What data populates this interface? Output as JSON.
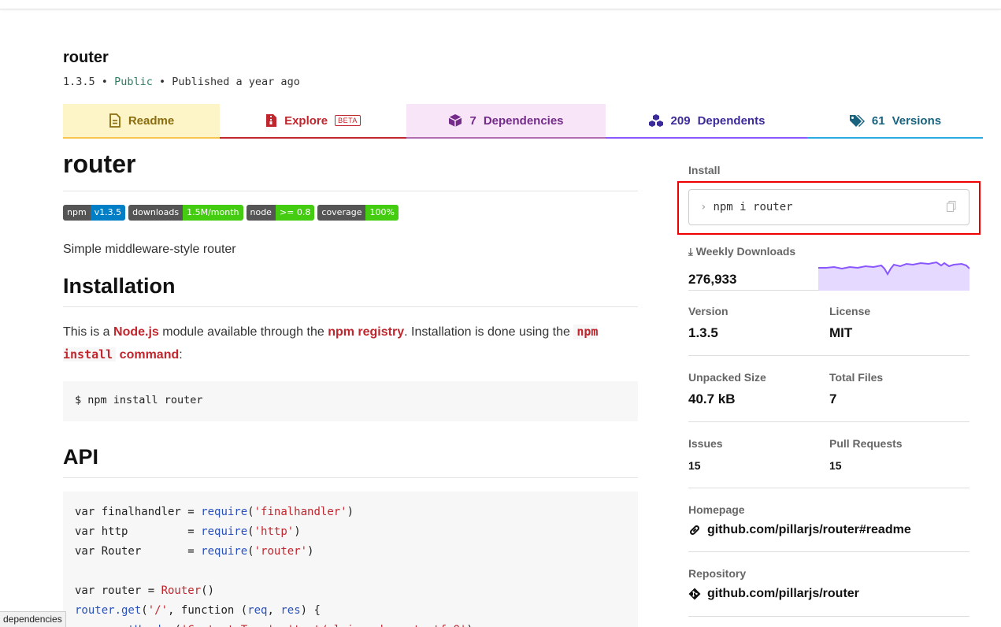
{
  "package": {
    "name": "router",
    "version": "1.3.5",
    "visibility": "Public",
    "published": "Published a year ago",
    "separator": "•"
  },
  "tabs": {
    "readme": "Readme",
    "explore": "Explore",
    "explore_badge": "BETA",
    "deps_count": "7",
    "deps_label": "Dependencies",
    "dependents_count": "209",
    "dependents_label": "Dependents",
    "versions_count": "61",
    "versions_label": "Versions"
  },
  "readme": {
    "title": "router",
    "badges": [
      {
        "label": "npm",
        "value": "v1.3.5",
        "color": "#007ec6"
      },
      {
        "label": "downloads",
        "value": "1.5M/month",
        "color": "#4c1"
      },
      {
        "label": "node",
        "value": ">= 0.8",
        "color": "#4c1"
      },
      {
        "label": "coverage",
        "value": "100%",
        "color": "#4c1"
      }
    ],
    "description": "Simple middleware-style router",
    "installation_heading": "Installation",
    "install_p1": "This is a ",
    "install_link1": "Node.js",
    "install_p2": " module available through the ",
    "install_link2": "npm registry",
    "install_p3": ". Installation is done using the ",
    "install_code": "npm install",
    "install_link3": "command",
    "install_p4": ":",
    "install_cmd": "$ npm install router",
    "api_heading": "API"
  },
  "sidebar": {
    "install_label": "Install",
    "install_cmd": "npm i router",
    "weekly_label": "Weekly Downloads",
    "weekly_value": "276,933",
    "version_label": "Version",
    "version_value": "1.3.5",
    "license_label": "License",
    "license_value": "MIT",
    "size_label": "Unpacked Size",
    "size_value": "40.7 kB",
    "files_label": "Total Files",
    "files_value": "7",
    "issues_label": "Issues",
    "issues_value": "15",
    "prs_label": "Pull Requests",
    "prs_value": "15",
    "homepage_label": "Homepage",
    "homepage_value": "github.com/pillarjs/router#readme",
    "repo_label": "Repository",
    "repo_value": "github.com/pillarjs/router"
  },
  "status_tip": "dependencies",
  "colors": {
    "accent_red": "#c0262d",
    "chart_line": "#8956ff",
    "chart_fill": "#e6d9ff"
  }
}
